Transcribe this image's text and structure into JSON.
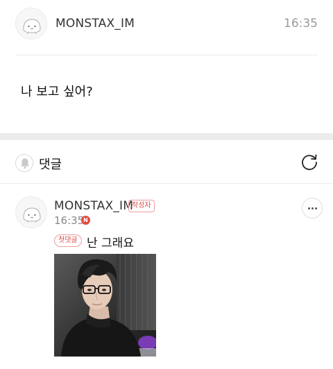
{
  "post": {
    "author": "MONSTAX_IM",
    "time": "16:35",
    "body": "나 보고 싶어?"
  },
  "comments_section": {
    "title": "댓글"
  },
  "comment": {
    "author": "MONSTAX_IM",
    "author_badge": "작성자",
    "time": "16:35",
    "new_badge": "N",
    "first_comment_badge": "첫댓글",
    "text": "난 그래요"
  },
  "colors": {
    "badge_red": "#e04848",
    "new_dot": "#e24a3f",
    "section_gap": "#ececec"
  },
  "icons": {
    "bell": "bell-icon",
    "refresh": "refresh-icon",
    "more": "more-icon"
  }
}
